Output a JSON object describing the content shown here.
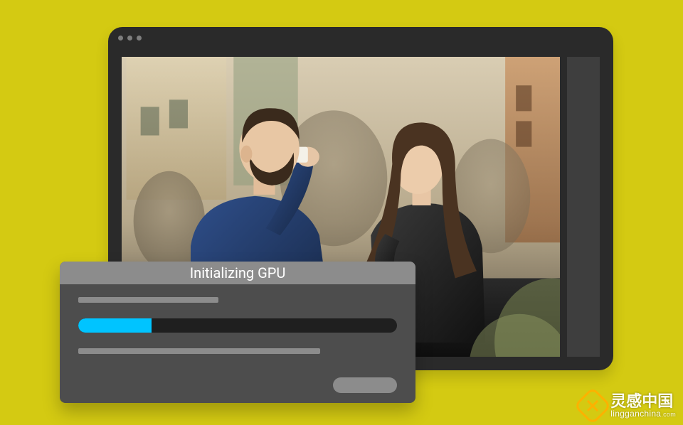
{
  "dialog": {
    "title": "Initializing GPU",
    "progress_pct": 23
  },
  "watermark": {
    "main": "灵感中国",
    "sub": "lingganchina",
    "tld": ".com"
  }
}
